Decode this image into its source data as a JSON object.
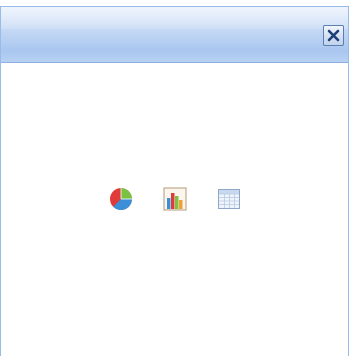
{
  "window": {
    "title": "",
    "close_label": "×"
  },
  "toolbar": {
    "icons": [
      "pie-chart-icon",
      "bar-chart-icon",
      "table-icon"
    ]
  },
  "colors": {
    "header_blue": "#a9c6f0",
    "border_blue": "#99bbe8",
    "pie_red": "#e03a3a",
    "pie_blue": "#3a8fd8",
    "pie_green": "#7cc242"
  }
}
